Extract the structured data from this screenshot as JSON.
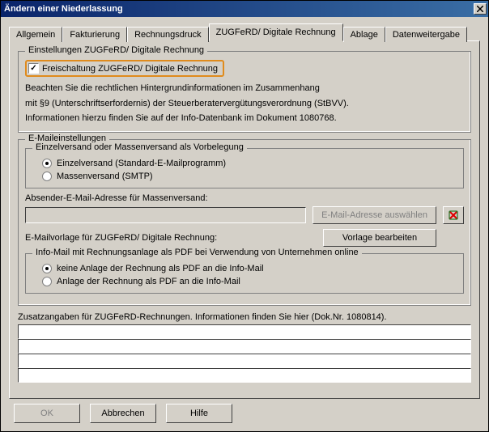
{
  "window": {
    "title": "Ändern einer Niederlassung"
  },
  "tabs": {
    "items": [
      {
        "label": "Allgemein"
      },
      {
        "label": "Fakturierung"
      },
      {
        "label": "Rechnungsdruck"
      },
      {
        "label": "ZUGFeRD/ Digitale Rechnung"
      },
      {
        "label": "Ablage"
      },
      {
        "label": "Datenweitergabe"
      }
    ]
  },
  "main_group": {
    "title": "Einstellungen ZUGFeRD/ Digitale Rechnung",
    "activation_label": "Freischaltung ZUGFeRD/ Digitale Rechnung",
    "info1": "Beachten Sie die rechtlichen Hintergrundinformationen im Zusammenhang",
    "info2": "mit §9 (Unterschriftserfordernis) der Steuerberatervergütungsverordnung (StBVV).",
    "info3": "Informationen hierzu finden Sie auf der Info-Datenbank im Dokument 1080768."
  },
  "email_group": {
    "title": "E-Maileinstellungen",
    "send_group_title": "Einzelversand oder Massenversand als Vorbelegung",
    "option_single": "Einzelversand (Standard-E-Mailprogramm)",
    "option_mass": "Massenversand (SMTP)",
    "sender_label": "Absender-E-Mail-Adresse für Massenversand:",
    "select_btn": "E-Mail-Adresse auswählen",
    "template_label": "E-Mailvorlage für ZUGFeRD/ Digitale Rechnung:",
    "template_btn": "Vorlage bearbeiten",
    "infomail_title": "Info-Mail mit Rechnungsanlage als PDF bei Verwendung von Unternehmen online",
    "option_no_attach": "keine Anlage der Rechnung als PDF an die Info-Mail",
    "option_attach": "Anlage der Rechnung als PDF an die Info-Mail"
  },
  "extra": {
    "label": "Zusatzangaben für ZUGFeRD-Rechnungen. Informationen finden Sie hier (Dok.Nr. 1080814)."
  },
  "buttons": {
    "ok": "OK",
    "cancel": "Abbrechen",
    "help": "Hilfe"
  }
}
